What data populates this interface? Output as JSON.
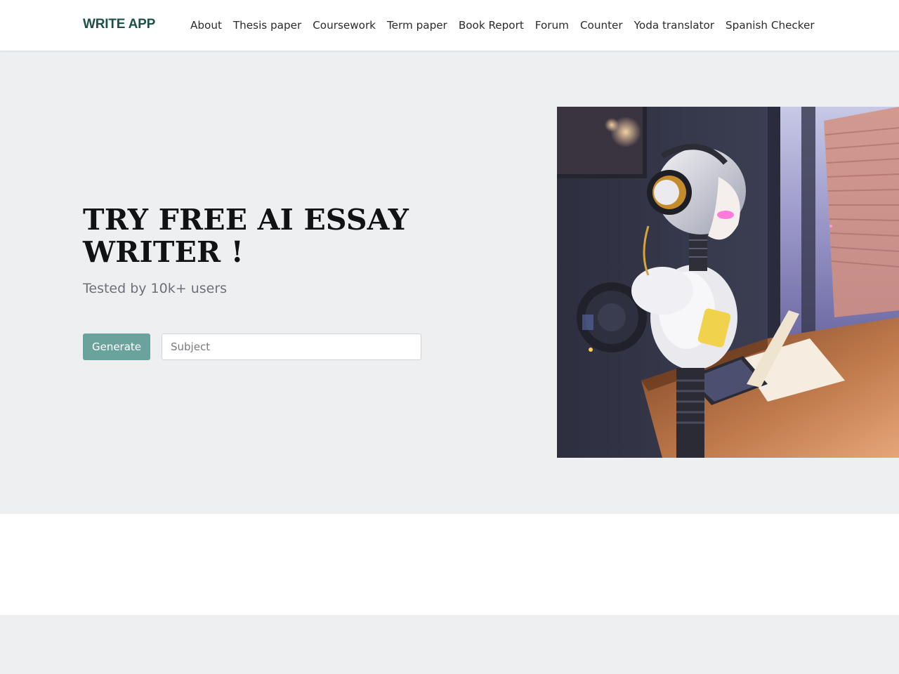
{
  "header": {
    "brand": "WRITE APP",
    "nav": [
      {
        "label": "About"
      },
      {
        "label": "Thesis paper"
      },
      {
        "label": "Coursework"
      },
      {
        "label": "Term paper"
      },
      {
        "label": "Book Report"
      },
      {
        "label": "Forum"
      },
      {
        "label": "Counter"
      },
      {
        "label": "Yoda translator"
      },
      {
        "label": "Spanish Checker"
      }
    ]
  },
  "hero": {
    "title": "TRY FREE AI ESSAY WRITER !",
    "subtitle": "Tested by 10k+ users",
    "generate_label": "Generate",
    "subject_placeholder": "Subject",
    "subject_value": "",
    "image_icon": "robot-with-laptop-illustration"
  },
  "colors": {
    "brand": "#1c5048",
    "accent_button": "#6aa39c",
    "page_background": "#eeeff1",
    "title_text": "#111214",
    "subtitle_text": "#6c7079"
  }
}
